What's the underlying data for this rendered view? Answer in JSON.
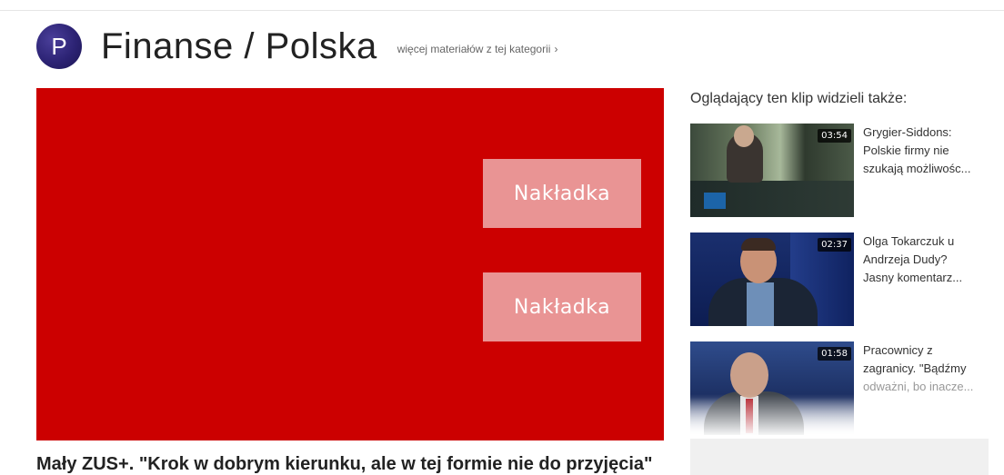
{
  "header": {
    "logo_letter": "P",
    "title": "Finanse / Polska",
    "more_link": "więcej materiałów z tej kategorii",
    "more_chevron": "›"
  },
  "player": {
    "overlay1": "Nakładka",
    "overlay2": "Nakładka"
  },
  "video_title": "Mały ZUS+. \"Krok w dobrym kierunku, ale w tej formie nie do przyjęcia\"",
  "sidebar": {
    "heading": "Oglądający ten klip widzieli także:",
    "items": [
      {
        "duration": "03:54",
        "lines": [
          "Grygier-Siddons:",
          "Polskie firmy nie",
          "szukają możliwośc..."
        ]
      },
      {
        "duration": "02:37",
        "lines": [
          "Olga Tokarczuk u",
          "Andrzeja Dudy?",
          "Jasny komentarz..."
        ]
      },
      {
        "duration": "01:58",
        "lines": [
          "Pracownicy z",
          "zagranicy. \"Bądźmy",
          "odważni, bo inacze..."
        ]
      }
    ]
  },
  "colors": {
    "player_bg": "#cc0000",
    "overlay_bg": "#e99494",
    "logo_bg": "#2c2374"
  },
  "icons": {
    "logo": "channel-logo-p",
    "chevron": "chevron-right-icon"
  }
}
